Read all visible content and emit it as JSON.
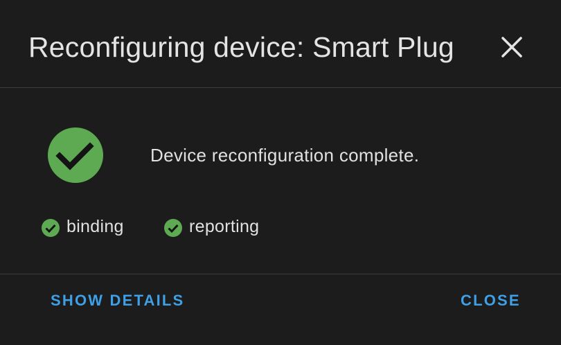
{
  "dialog": {
    "title": "Reconfiguring device: Smart Plug",
    "close_icon": "close-icon"
  },
  "status": {
    "icon": "check-circle-icon",
    "message": "Device reconfiguration complete."
  },
  "steps": [
    {
      "label": "binding",
      "icon": "check-circle-icon"
    },
    {
      "label": "reporting",
      "icon": "check-circle-icon"
    }
  ],
  "actions": {
    "show_details_label": "SHOW DETAILS",
    "close_label": "CLOSE"
  },
  "colors": {
    "background": "#1c1c1c",
    "success": "#5daa52",
    "accent": "#3ea0e6",
    "text": "#e1e1e1",
    "divider": "#3e3e3e"
  }
}
